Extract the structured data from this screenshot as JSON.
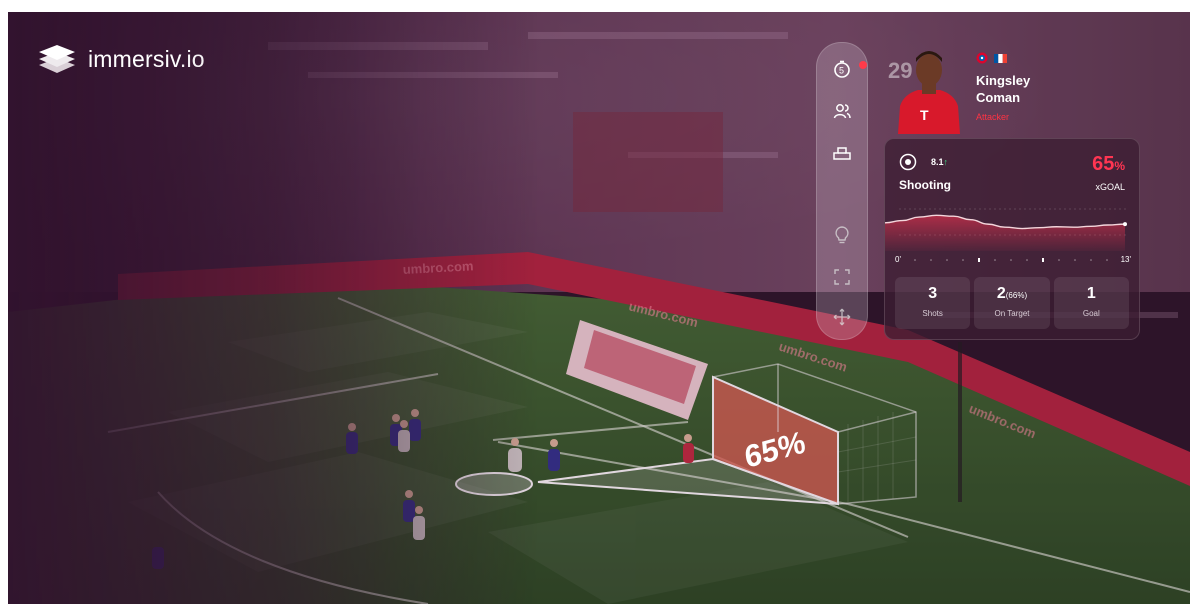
{
  "brand": {
    "name": "immersiv",
    "tld": ".io"
  },
  "toolbar": {
    "items": [
      {
        "icon": "stopwatch-icon",
        "notification": true
      },
      {
        "icon": "users-icon"
      },
      {
        "icon": "formation-icon"
      },
      {
        "icon": "lightbulb-icon"
      },
      {
        "icon": "fullscreen-icon"
      },
      {
        "icon": "move-icon"
      }
    ]
  },
  "player": {
    "number": "29",
    "first_name": "Kingsley",
    "last_name": "Coman",
    "position": "Attacker",
    "club_badge": "bayern-munich-badge",
    "flag": "france-flag",
    "kit_color": "#d8192b"
  },
  "panel": {
    "metric": "Shooting",
    "rating": "8.1",
    "rating_trend": "↑",
    "value": "65",
    "unit": "%",
    "value_label": "xGOAL",
    "axis_start": "0'",
    "axis_end": "13'",
    "sparkline": [
      0.55,
      0.6,
      0.68,
      0.72,
      0.7,
      0.62,
      0.52,
      0.45,
      0.42,
      0.44,
      0.46,
      0.45,
      0.47,
      0.5,
      0.52
    ],
    "stats": [
      {
        "value": "3",
        "sub": "",
        "label": "Shots"
      },
      {
        "value": "2",
        "sub": "(66%)",
        "label": "On Target"
      },
      {
        "value": "1",
        "sub": "",
        "label": "Goal"
      }
    ]
  },
  "field_overlay": {
    "goal_probability": "65%"
  },
  "colors": {
    "accent": "#ff3552",
    "overlay": "#ff5a50",
    "pitch": "#2e5a24"
  }
}
